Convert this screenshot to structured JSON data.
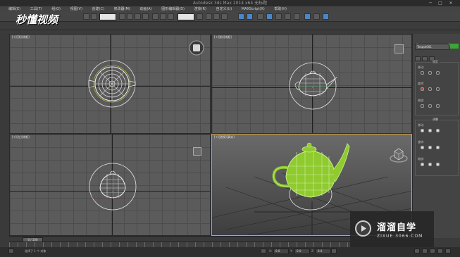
{
  "window": {
    "title": "Autodesk 3ds Max 2014 x64    无标题",
    "controls": [
      "─",
      "□",
      "✕"
    ]
  },
  "logo": {
    "text": "秒懂视频"
  },
  "menu": {
    "items": [
      "编辑(E)",
      "工具(T)",
      "组(G)",
      "视图(V)",
      "创建(C)",
      "修改器(M)",
      "动画(A)",
      "图形编辑器(D)",
      "渲染(R)",
      "自定义(U)",
      "MAXScript(X)",
      "帮助(H)"
    ]
  },
  "viewports": {
    "top": {
      "label": "[+][顶][线框]"
    },
    "front": {
      "label": "[+][前][线框]"
    },
    "left": {
      "label": "[+][左][线框]"
    },
    "perspective": {
      "label": "[+][透视][真实]"
    }
  },
  "panel": {
    "tabs": [
      "✚",
      "◐",
      "▲",
      "◉",
      "▭",
      "⚒"
    ],
    "object_name": "Teapot001",
    "color": "#3ca53a",
    "groups": {
      "pivot_title": "调整",
      "pivot_move": "移动:",
      "pivot_rotate": "旋转:",
      "pivot_scale": "缩放:",
      "axis_title": "轴",
      "axis_x": "X",
      "axis_y": "Y",
      "axis_z": "Z",
      "lock_title": "锁定",
      "lock_move": "移动:",
      "lock_rotate": "旋转:",
      "lock_scale": "缩放:"
    }
  },
  "timeline": {
    "slider": "0 / 100"
  },
  "statusbar": {
    "text": "选择了 1 个 对象",
    "x_label": "X:",
    "x_value": "0.0",
    "y_label": "Y:",
    "y_value": "0.0",
    "z_label": "Z:",
    "z_value": "0.0"
  },
  "watermark": {
    "brand": "溜溜自学",
    "url": "ZIXUE.3066.COM"
  }
}
